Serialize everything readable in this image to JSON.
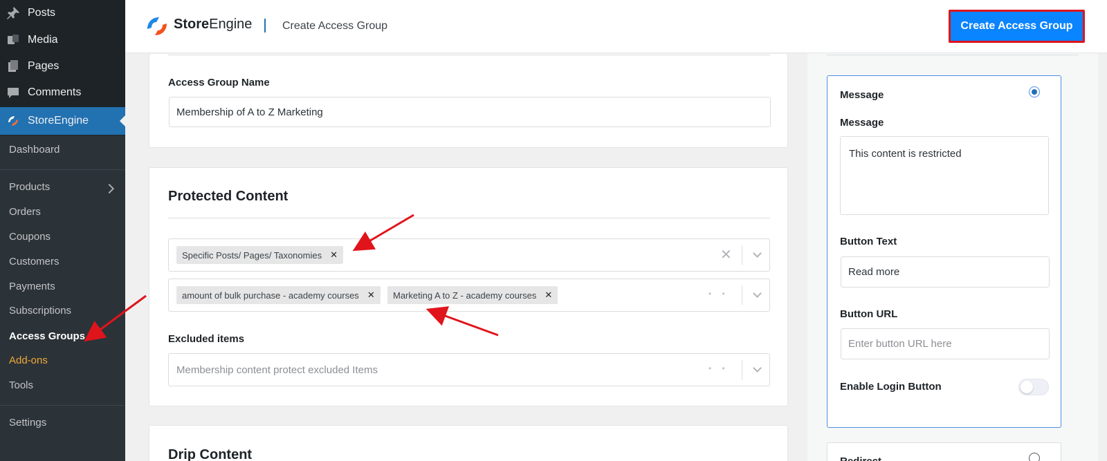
{
  "sidebar": {
    "top_items": [
      {
        "label": "Posts",
        "icon": "pin-icon"
      },
      {
        "label": "Media",
        "icon": "media-icon"
      },
      {
        "label": "Pages",
        "icon": "pages-icon"
      },
      {
        "label": "Comments",
        "icon": "comments-icon"
      }
    ],
    "active": {
      "label": "StoreEngine",
      "icon": "storeengine-icon"
    },
    "sub_items": [
      "Dashboard",
      "Products",
      "Orders",
      "Coupons",
      "Customers",
      "Payments",
      "Subscriptions",
      "Access Groups",
      "Add-ons",
      "Tools",
      "Settings"
    ]
  },
  "header": {
    "brand_bold": "Store",
    "brand_rest": "Engine",
    "title": "Create Access Group",
    "create_button": "Create Access Group"
  },
  "main": {
    "name_label": "Access Group Name",
    "name_value": "Membership of A to Z Marketing",
    "protected_title": "Protected Content",
    "type_chip": "Specific Posts/ Pages/ Taxonomies",
    "item_chips": [
      "amount of bulk purchase - academy courses",
      "Marketing A to Z - academy courses"
    ],
    "excluded_label": "Excluded items",
    "excluded_placeholder": "Membership content protect excluded Items",
    "drip_title": "Drip Content"
  },
  "right": {
    "message_option": "Message",
    "message_label": "Message",
    "message_value": "This content is restricted",
    "button_text_label": "Button Text",
    "button_text_value": "Read more",
    "button_url_label": "Button URL",
    "button_url_placeholder": "Enter button URL here",
    "login_label": "Enable Login Button",
    "redirect_option": "Redirect"
  },
  "colors": {
    "accent": "#2271b1",
    "button": "#0a84ff",
    "highlight": "#e0141b",
    "addons": "#f0a838"
  }
}
